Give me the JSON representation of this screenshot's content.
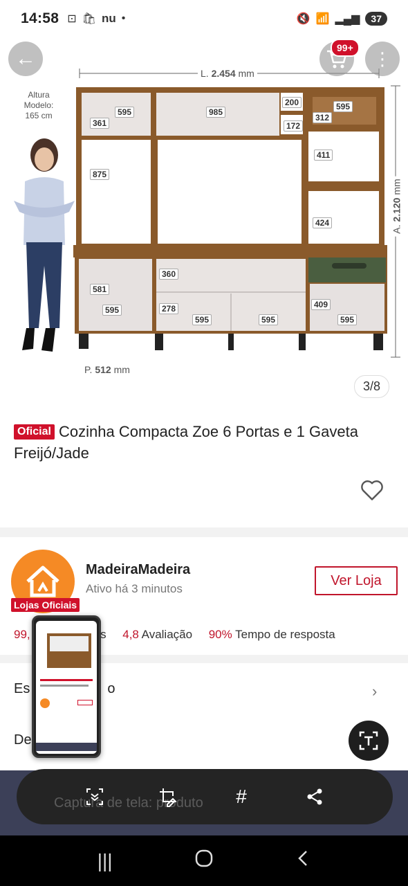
{
  "status_bar": {
    "time": "14:58",
    "left_icons": [
      "screenshot-icon",
      "shop-icon",
      "nu-icon",
      "dot"
    ],
    "carrier_text": "nu",
    "battery": "37"
  },
  "header": {
    "cart_badge": "99+"
  },
  "product_image": {
    "counter": "3/8",
    "model_height_label": "Altura\nModelo:\n165 cm",
    "width_label_prefix": "L.",
    "width_value": "2.454",
    "width_unit": "mm",
    "height_label_prefix": "A.",
    "height_value": "2.120",
    "height_unit": "mm",
    "depth_label_prefix": "P.",
    "depth_value": "512",
    "depth_unit": "mm",
    "dims": [
      "595",
      "985",
      "200",
      "595",
      "361",
      "172",
      "312",
      "875",
      "411",
      "424",
      "360",
      "581",
      "595",
      "278",
      "595",
      "595",
      "409",
      "595"
    ]
  },
  "product": {
    "badge": "Oficial",
    "title": "Cozinha Compacta Zoe 6 Portas e 1 Gaveta Freijó/Jade"
  },
  "store": {
    "name": "MadeiraMadeira",
    "status": "Ativo há 3 minutos",
    "tag": "Lojas Oficiais",
    "button": "Ver Loja",
    "stats": [
      {
        "value": "99,",
        "label": "os"
      },
      {
        "value": "4,8",
        "label": "Avaliação"
      },
      {
        "value": "90%",
        "label": "Tempo de resposta"
      }
    ]
  },
  "rows": {
    "row1_start": "Es",
    "row1_end": "o",
    "row2_start": "De"
  },
  "toolbar": {
    "ghost_text": "Captura de tela: produto"
  },
  "colors": {
    "brand_red": "#d0112b",
    "store_orange": "#f58a25",
    "cabinet_wood": "#8a5a2b",
    "drawer_jade": "#4a5e40"
  }
}
